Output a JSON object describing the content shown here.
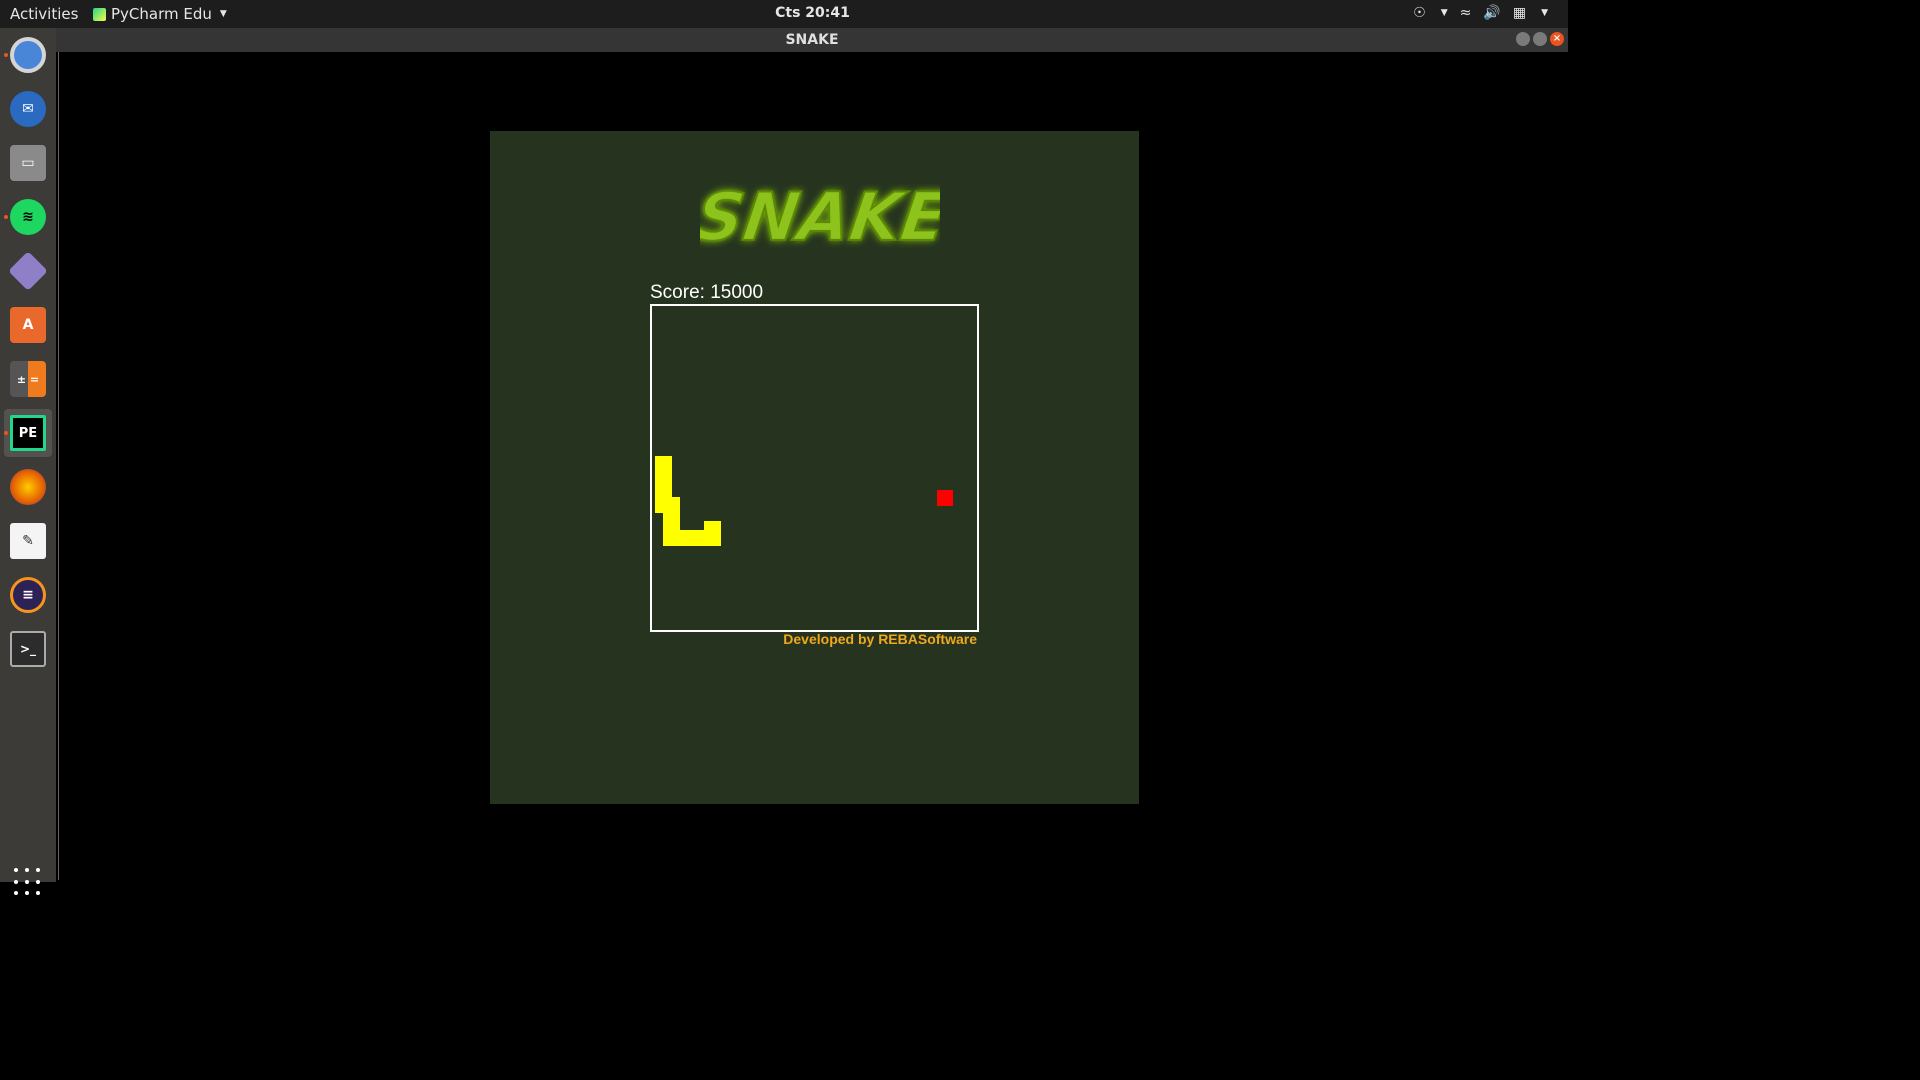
{
  "topbar": {
    "activities": "Activities",
    "app_name": "PyCharm Edu",
    "clock": "Cts 20:41"
  },
  "window": {
    "title": "SNAKE"
  },
  "game": {
    "logo_text": "SNAKE",
    "score_label": "Score: 15000",
    "credit": "Developed by REBASoftware"
  },
  "dock": {
    "items": [
      "chromium-icon",
      "thunderbird-icon",
      "files-icon",
      "spotify-icon",
      "draw-icon",
      "software-center-icon",
      "calculator-icon",
      "pycharm-edu-icon",
      "firefox-icon",
      "text-editor-icon",
      "eclipse-icon",
      "terminal-icon"
    ]
  },
  "colors": {
    "panel": "#25331f",
    "snake": "#ffff00",
    "food": "#ff0000",
    "credit": "#f0a81c"
  }
}
